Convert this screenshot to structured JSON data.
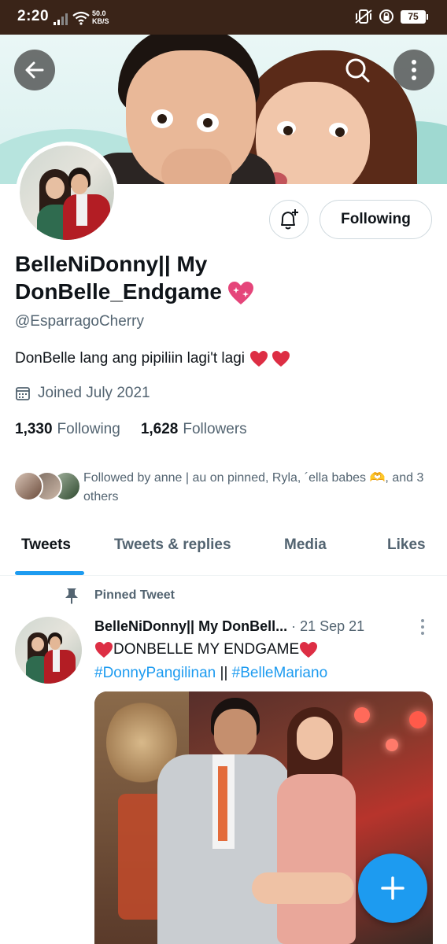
{
  "status_bar": {
    "time": "2:20",
    "net_speed_value": "50.0",
    "net_speed_unit": "KB/S",
    "battery": "75"
  },
  "header": {
    "back_icon": "arrow-left-icon",
    "search_icon": "search-icon",
    "more_icon": "more-vertical-icon"
  },
  "profile": {
    "display_name": "BelleNiDonny|| My DonBelle_Endgame",
    "handle": "@EsparragoCherry",
    "bio": "DonBelle lang ang pipiliin lagi't lagi",
    "joined": "Joined July 2021",
    "following_count": "1,330",
    "following_label": "Following",
    "followers_count": "1,628",
    "followers_label": "Followers",
    "followed_by": "Followed by anne | au on pinned, Ryla, ´ella babes 🫶, and 3 others",
    "follow_button_label": "Following"
  },
  "tabs": [
    {
      "label": "Tweets",
      "active": true
    },
    {
      "label": "Tweets & replies",
      "active": false
    },
    {
      "label": "Media",
      "active": false
    },
    {
      "label": "Likes",
      "active": false
    }
  ],
  "pinned_tweet": {
    "pinned_label": "Pinned Tweet",
    "author": "BelleNiDonny|| My DonBell...",
    "separator": " · ",
    "date": "21 Sep 21",
    "text": "DONBELLE MY ENDGAME",
    "hashtag1": "#DonnyPangilinan",
    "between": " || ",
    "hashtag2": "#BelleMariano"
  },
  "colors": {
    "accent": "#1d9bf0",
    "text_primary": "#0f1419",
    "text_secondary": "#536471",
    "heart": "#e0245e"
  }
}
